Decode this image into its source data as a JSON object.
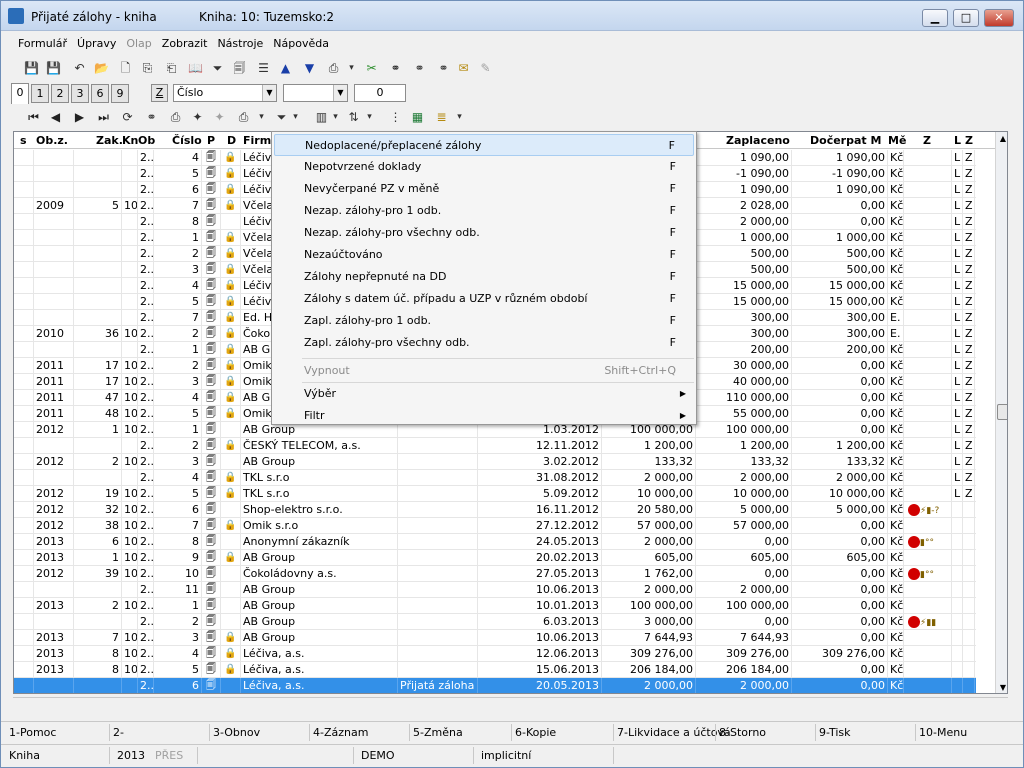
{
  "window": {
    "title": "Přijaté zálohy - kniha",
    "subtitle": "Kniha: 10: Tuzemsko:2",
    "min": "▁",
    "max": "□",
    "close": "✕"
  },
  "menu": [
    "Formulář",
    "Úpravy",
    "Olap",
    "Zobrazit",
    "Nástroje",
    "Nápověda"
  ],
  "menu_disabled": [
    false,
    false,
    true,
    false,
    false,
    false
  ],
  "toolbar1_icons": [
    "save-icon",
    "save-all-icon",
    "undo-icon",
    "open-folder-icon",
    "new-document-icon",
    "copy-icon",
    "copy-record-icon",
    "book-icon",
    "filter-icon",
    "document-filter-icon",
    "stack-icon",
    "arrow-up-icon",
    "arrow-down-icon",
    "camera-icon",
    "chevron-down-icon",
    "scissors-icon",
    "binoculars-icon",
    "binoculars-next-icon",
    "binoculars-replace-icon",
    "mail-icon",
    "edit-disabled-icon"
  ],
  "tabs": [
    "0",
    "1",
    "2",
    "3",
    "6",
    "9"
  ],
  "z_button": "Z",
  "sort_combo": "Číslo",
  "filter_value": "",
  "counter_value": "0",
  "toolbar2_icons": [
    "first-record-icon",
    "prev-record-icon",
    "next-record-icon",
    "last-record-icon",
    "refresh-icon",
    "find-icon",
    "print-icon",
    "wizard-icon",
    "wizard-disabled-icon",
    "camera-icon",
    "chevron-down-icon",
    "funnel-icon",
    "funnel-dropdown-icon",
    "columns-icon",
    "chevron-down-icon",
    "sort-az-icon",
    "chevron-down-icon",
    "tree-icon",
    "excel-icon",
    "list-icon",
    "chevron-down-icon"
  ],
  "headers": [
    "s",
    "Ob.z.",
    "Zak.",
    "Kn",
    "Ob",
    "Číslo",
    "P",
    "D",
    "Firm",
    "Zaplaceno",
    "Dočerpat M",
    "Mě",
    "Z",
    "L",
    "Z"
  ],
  "rows": [
    {
      "obz": "",
      "zak": "",
      "kn": "",
      "ob": "2..",
      "cis": "4",
      "lock": true,
      "firm": "Léčiva",
      "text": "",
      "date": "",
      "amt": "",
      "paid": "1 090,00",
      "doc": "1 090,00",
      "cur": "Kč",
      "z": "",
      "l": "L",
      "z2": "Z"
    },
    {
      "obz": "",
      "zak": "",
      "kn": "",
      "ob": "2..",
      "cis": "5",
      "lock": true,
      "firm": "Léčiva",
      "text": "",
      "date": "",
      "amt": "",
      "paid": "-1 090,00",
      "doc": "-1 090,00",
      "cur": "Kč",
      "z": "",
      "l": "L",
      "z2": "Z"
    },
    {
      "obz": "",
      "zak": "",
      "kn": "",
      "ob": "2..",
      "cis": "6",
      "lock": true,
      "firm": "Léčiva",
      "text": "",
      "date": "",
      "amt": "",
      "paid": "1 090,00",
      "doc": "1 090,00",
      "cur": "Kč",
      "z": "",
      "l": "L",
      "z2": "Z"
    },
    {
      "obz": "2009",
      "zak": "5",
      "kn": "10",
      "ob": "2..",
      "cis": "7",
      "lock": true,
      "firm": "Včela",
      "text": "",
      "date": "",
      "amt": "",
      "paid": "2 028,00",
      "doc": "0,00",
      "cur": "Kč",
      "z": "",
      "l": "L",
      "z2": "Z"
    },
    {
      "obz": "",
      "zak": "",
      "kn": "",
      "ob": "2..",
      "cis": "8",
      "lock": false,
      "firm": "Léčiva",
      "text": "",
      "date": "",
      "amt": "",
      "paid": "2 000,00",
      "doc": "0,00",
      "cur": "Kč",
      "z": "",
      "l": "L",
      "z2": "Z"
    },
    {
      "obz": "",
      "zak": "",
      "kn": "",
      "ob": "2..",
      "cis": "1",
      "lock": true,
      "firm": "Včela",
      "text": "",
      "date": "",
      "amt": "",
      "paid": "1 000,00",
      "doc": "1 000,00",
      "cur": "Kč",
      "z": "",
      "l": "L",
      "z2": "Z"
    },
    {
      "obz": "",
      "zak": "",
      "kn": "",
      "ob": "2..",
      "cis": "2",
      "lock": true,
      "firm": "Včela",
      "text": "",
      "date": "",
      "amt": "",
      "paid": "500,00",
      "doc": "500,00",
      "cur": "Kč",
      "z": "",
      "l": "L",
      "z2": "Z"
    },
    {
      "obz": "",
      "zak": "",
      "kn": "",
      "ob": "2..",
      "cis": "3",
      "lock": true,
      "firm": "Včela",
      "text": "",
      "date": "",
      "amt": "",
      "paid": "500,00",
      "doc": "500,00",
      "cur": "Kč",
      "z": "",
      "l": "L",
      "z2": "Z"
    },
    {
      "obz": "",
      "zak": "",
      "kn": "",
      "ob": "2..",
      "cis": "4",
      "lock": true,
      "firm": "Léčiva",
      "text": "",
      "date": "",
      "amt": "",
      "paid": "15 000,00",
      "doc": "15 000,00",
      "cur": "Kč",
      "z": "",
      "l": "L",
      "z2": "Z"
    },
    {
      "obz": "",
      "zak": "",
      "kn": "",
      "ob": "2..",
      "cis": "5",
      "lock": true,
      "firm": "Léčiva",
      "text": "",
      "date": "",
      "amt": "",
      "paid": "15 000,00",
      "doc": "15 000,00",
      "cur": "Kč",
      "z": "",
      "l": "L",
      "z2": "Z"
    },
    {
      "obz": "",
      "zak": "",
      "kn": "",
      "ob": "2..",
      "cis": "7",
      "lock": true,
      "firm": "Ed. H",
      "text": "",
      "date": "",
      "amt": "",
      "paid": "300,00",
      "doc": "300,00",
      "cur": "E.",
      "z": "",
      "l": "L",
      "z2": "Z"
    },
    {
      "obz": "2010",
      "zak": "36",
      "kn": "10",
      "ob": "2..",
      "cis": "2",
      "lock": true,
      "firm": "Čokol",
      "text": "",
      "date": "",
      "amt": "",
      "paid": "300,00",
      "doc": "300,00",
      "cur": "E.",
      "z": "",
      "l": "L",
      "z2": "Z"
    },
    {
      "obz": "",
      "zak": "",
      "kn": "",
      "ob": "2..",
      "cis": "1",
      "lock": true,
      "firm": "AB Gr",
      "text": "",
      "date": "",
      "amt": "",
      "paid": "200,00",
      "doc": "200,00",
      "cur": "Kč",
      "z": "",
      "l": "L",
      "z2": "Z"
    },
    {
      "obz": "2011",
      "zak": "17",
      "kn": "10",
      "ob": "2..",
      "cis": "2",
      "lock": true,
      "firm": "Omik",
      "text": "",
      "date": "",
      "amt": "",
      "paid": "30 000,00",
      "doc": "0,00",
      "cur": "Kč",
      "z": "",
      "l": "L",
      "z2": "Z"
    },
    {
      "obz": "2011",
      "zak": "17",
      "kn": "10",
      "ob": "2..",
      "cis": "3",
      "lock": true,
      "firm": "Omik",
      "text": "",
      "date": "",
      "amt": "",
      "paid": "40 000,00",
      "doc": "0,00",
      "cur": "Kč",
      "z": "",
      "l": "L",
      "z2": "Z"
    },
    {
      "obz": "2011",
      "zak": "47",
      "kn": "10",
      "ob": "2..",
      "cis": "4",
      "lock": true,
      "firm": "AB Gr",
      "text": "",
      "date": "",
      "amt": "",
      "paid": "110 000,00",
      "doc": "0,00",
      "cur": "Kč",
      "z": "",
      "l": "L",
      "z2": "Z"
    },
    {
      "obz": "2011",
      "zak": "48",
      "kn": "10",
      "ob": "2..",
      "cis": "5",
      "lock": true,
      "firm": "Omik",
      "text": "",
      "date": "",
      "amt": "",
      "paid": "55 000,00",
      "doc": "0,00",
      "cur": "Kč",
      "z": "",
      "l": "L",
      "z2": "Z"
    },
    {
      "obz": "2012",
      "zak": "1",
      "kn": "10",
      "ob": "2..",
      "cis": "1",
      "lock": false,
      "firm": "AB Group",
      "text": "",
      "date": "1.03.2012",
      "amt": "100 000,00",
      "paid": "100 000,00",
      "doc": "0,00",
      "cur": "Kč",
      "z": "",
      "l": "L",
      "z2": "Z"
    },
    {
      "obz": "",
      "zak": "",
      "kn": "",
      "ob": "2..",
      "cis": "2",
      "lock": true,
      "firm": "ČESKÝ TELECOM, a.s.",
      "text": "",
      "date": "12.11.2012",
      "amt": "1 200,00",
      "paid": "1 200,00",
      "doc": "1 200,00",
      "cur": "Kč",
      "z": "",
      "l": "L",
      "z2": "Z"
    },
    {
      "obz": "2012",
      "zak": "2",
      "kn": "10",
      "ob": "2..",
      "cis": "3",
      "lock": false,
      "firm": "AB Group",
      "text": "",
      "date": "3.02.2012",
      "amt": "133,32",
      "paid": "133,32",
      "doc": "133,32",
      "cur": "Kč",
      "z": "",
      "l": "L",
      "z2": "Z"
    },
    {
      "obz": "",
      "zak": "",
      "kn": "",
      "ob": "2..",
      "cis": "4",
      "lock": true,
      "firm": "TKL s.r.o",
      "text": "",
      "date": "31.08.2012",
      "amt": "2 000,00",
      "paid": "2 000,00",
      "doc": "2 000,00",
      "cur": "Kč",
      "z": "",
      "l": "L",
      "z2": "Z"
    },
    {
      "obz": "2012",
      "zak": "19",
      "kn": "10",
      "ob": "2..",
      "cis": "5",
      "lock": true,
      "firm": "TKL s.r.o",
      "text": "",
      "date": "5.09.2012",
      "amt": "10 000,00",
      "paid": "10 000,00",
      "doc": "10 000,00",
      "cur": "Kč",
      "z": "",
      "l": "L",
      "z2": "Z"
    },
    {
      "obz": "2012",
      "zak": "32",
      "kn": "10",
      "ob": "2..",
      "cis": "6",
      "lock": false,
      "firm": "Shop-elektro s.r.o.",
      "text": "",
      "date": "16.11.2012",
      "amt": "20 580,00",
      "paid": "5 000,00",
      "doc": "5 000,00",
      "cur": "Kč",
      "z": "status-warn",
      "l": "",
      "z2": ""
    },
    {
      "obz": "2012",
      "zak": "38",
      "kn": "10",
      "ob": "2..",
      "cis": "7",
      "lock": true,
      "firm": "Omik s.r.o",
      "text": "",
      "date": "27.12.2012",
      "amt": "57 000,00",
      "paid": "57 000,00",
      "doc": "0,00",
      "cur": "Kč",
      "z": "",
      "l": "",
      "z2": ""
    },
    {
      "obz": "2013",
      "zak": "6",
      "kn": "10",
      "ob": "2..",
      "cis": "8",
      "lock": false,
      "firm": "Anonymní zákazník",
      "text": "",
      "date": "24.05.2013",
      "amt": "2 000,00",
      "paid": "0,00",
      "doc": "0,00",
      "cur": "Kč",
      "z": "status-coins",
      "l": "",
      "z2": ""
    },
    {
      "obz": "2013",
      "zak": "1",
      "kn": "10",
      "ob": "2..",
      "cis": "9",
      "lock": true,
      "firm": "AB Group",
      "text": "",
      "date": "20.02.2013",
      "amt": "605,00",
      "paid": "605,00",
      "doc": "605,00",
      "cur": "Kč",
      "z": "",
      "l": "",
      "z2": ""
    },
    {
      "obz": "2012",
      "zak": "39",
      "kn": "10",
      "ob": "2..",
      "cis": "10",
      "lock": false,
      "firm": "Čokoládovny a.s.",
      "text": "",
      "date": "27.05.2013",
      "amt": "1 762,00",
      "paid": "0,00",
      "doc": "0,00",
      "cur": "Kč",
      "z": "status-coins",
      "l": "",
      "z2": ""
    },
    {
      "obz": "",
      "zak": "",
      "kn": "",
      "ob": "2..",
      "cis": "11",
      "lock": false,
      "firm": "AB Group",
      "text": "",
      "date": "10.06.2013",
      "amt": "2 000,00",
      "paid": "2 000,00",
      "doc": "0,00",
      "cur": "Kč",
      "z": "",
      "l": "",
      "z2": ""
    },
    {
      "obz": "2013",
      "zak": "2",
      "kn": "10",
      "ob": "2..",
      "cis": "1",
      "lock": false,
      "firm": "AB Group",
      "text": "",
      "date": "10.01.2013",
      "amt": "100 000,00",
      "paid": "100 000,00",
      "doc": "0,00",
      "cur": "Kč",
      "z": "",
      "l": "",
      "z2": ""
    },
    {
      "obz": "",
      "zak": "",
      "kn": "",
      "ob": "2..",
      "cis": "2",
      "lock": false,
      "firm": "AB Group",
      "text": "",
      "date": "6.03.2013",
      "amt": "3 000,00",
      "paid": "0,00",
      "doc": "0,00",
      "cur": "Kč",
      "z": "status-coins-lightning",
      "l": "",
      "z2": ""
    },
    {
      "obz": "2013",
      "zak": "7",
      "kn": "10",
      "ob": "2..",
      "cis": "3",
      "lock": true,
      "firm": "AB Group",
      "text": "",
      "date": "10.06.2013",
      "amt": "7 644,93",
      "paid": "7 644,93",
      "doc": "0,00",
      "cur": "Kč",
      "z": "",
      "l": "",
      "z2": ""
    },
    {
      "obz": "2013",
      "zak": "8",
      "kn": "10",
      "ob": "2..",
      "cis": "4",
      "lock": true,
      "firm": "Léčiva, a.s.",
      "text": "",
      "date": "12.06.2013",
      "amt": "309 276,00",
      "paid": "309 276,00",
      "doc": "309 276,00",
      "cur": "Kč",
      "z": "",
      "l": "",
      "z2": ""
    },
    {
      "obz": "2013",
      "zak": "8",
      "kn": "10",
      "ob": "2..",
      "cis": "5",
      "lock": true,
      "firm": "Léčiva, a.s.",
      "text": "",
      "date": "15.06.2013",
      "amt": "206 184,00",
      "paid": "206 184,00",
      "doc": "0,00",
      "cur": "Kč",
      "z": "",
      "l": "",
      "z2": ""
    },
    {
      "obz": "",
      "zak": "",
      "kn": "",
      "ob": "2..",
      "cis": "6",
      "lock": false,
      "firm": "Léčiva, a.s.",
      "text": "Přijatá záloha",
      "date": "20.05.2013",
      "amt": "2 000,00",
      "paid": "2 000,00",
      "doc": "0,00",
      "cur": "Kč",
      "z": "",
      "l": "",
      "z2": "",
      "selected": true
    }
  ],
  "popup": {
    "items": [
      {
        "label": "Nedoplacené/přeplacené zálohy",
        "shortcut": "F",
        "highlight": true
      },
      {
        "label": "Nepotvrzené doklady",
        "shortcut": "F"
      },
      {
        "label": "Nevyčerpané PZ v měně",
        "shortcut": "F"
      },
      {
        "label": "Nezap. zálohy-pro 1 odb.",
        "shortcut": "F"
      },
      {
        "label": "Nezap. zálohy-pro všechny odb.",
        "shortcut": "F"
      },
      {
        "label": "Nezaúčtováno",
        "shortcut": "F"
      },
      {
        "label": "Zálohy nepřepnuté na DD",
        "shortcut": "F"
      },
      {
        "label": "Zálohy s datem úč. případu a UZP v různém období",
        "shortcut": "F"
      },
      {
        "label": "Zapl. zálohy-pro 1 odb.",
        "shortcut": "F"
      },
      {
        "label": "Zapl. zálohy-pro všechny odb.",
        "shortcut": "F"
      }
    ],
    "off": {
      "label": "Vypnout",
      "shortcut": "Shift+Ctrl+Q"
    },
    "choose": "Výběr",
    "filter": "Filtr"
  },
  "fkeys": [
    "1-Pomoc",
    "2-",
    "3-Obnov",
    "4-Záznam",
    "5-Změna",
    "6-Kopie",
    "7-Likvidace a účtová",
    "8-Storno",
    "9-Tisk",
    "10-Menu"
  ],
  "status": {
    "book": "Kniha",
    "year": "2013",
    "pres": "PŘES",
    "company": "DEMO",
    "mode": "implicitní"
  }
}
